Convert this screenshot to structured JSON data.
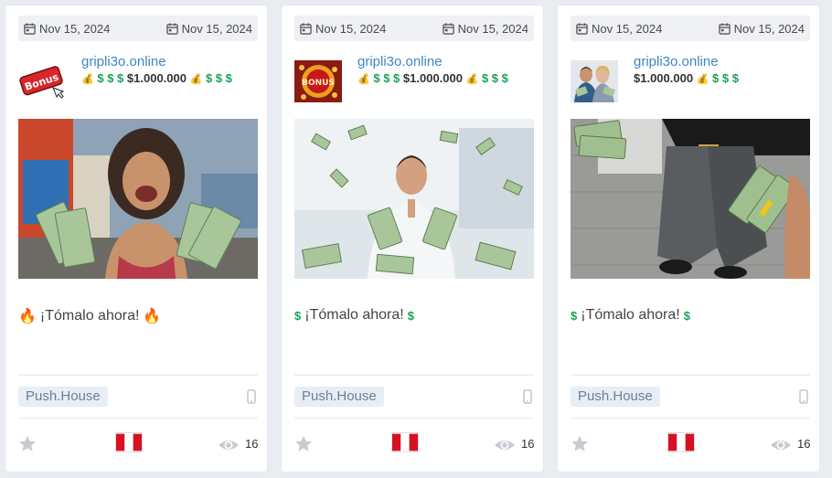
{
  "cards": [
    {
      "date_start": "Nov 15, 2024",
      "date_end": "Nov 15, 2024",
      "site": "gripli3o.online",
      "amount": "$1.000.000",
      "body_text": "¡Tómalo ahora!",
      "network": "Push.House",
      "views": "16",
      "thumb_text": "Bonus"
    },
    {
      "date_start": "Nov 15, 2024",
      "date_end": "Nov 15, 2024",
      "site": "gripli3o.online",
      "amount": "$1.000.000",
      "body_text": "¡Tómalo ahora!",
      "network": "Push.House",
      "views": "16",
      "thumb_text": "BONUS"
    },
    {
      "date_start": "Nov 15, 2024",
      "date_end": "Nov 15, 2024",
      "site": "gripli3o.online",
      "amount": "$1.000.000",
      "body_text": "¡Tómalo ahora!",
      "network": "Push.House",
      "views": "16"
    }
  ],
  "colors": {
    "link": "#3a86c8",
    "dollar": "#19a15a",
    "tag_bg": "#e8eef5",
    "flag_red": "#d91023"
  },
  "icons": [
    "calendar-icon",
    "money-bag-icon",
    "dollar-icon",
    "fire-icon",
    "mobile-device-icon",
    "star-icon",
    "peru-flag-icon",
    "eye-icon"
  ]
}
